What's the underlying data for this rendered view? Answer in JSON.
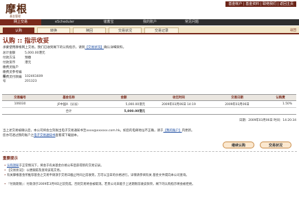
{
  "header": {
    "logo_text": "摩根",
    "logo_sub": "基金管理",
    "top_links": "基金帐户 | 基金资料 | 联络我们 | 返回主页"
  },
  "nav": {
    "items": [
      {
        "label": "网上交易"
      },
      {
        "label": "eScheduler"
      },
      {
        "label": "储蓄宝"
      },
      {
        "label": "我的账户"
      },
      {
        "label": "常见问题"
      }
    ]
  },
  "subtabs": {
    "items": [
      {
        "label": "认购"
      },
      {
        "label": "转换"
      },
      {
        "label": "赎回"
      },
      {
        "label": "交易状况"
      },
      {
        "label": "交易记录"
      }
    ],
    "back_label": "返回"
  },
  "page": {
    "title": "认购 :: 指示收妥",
    "instruction_pre": "承蒙使用摩根网上交易。我们已收到阁下的认购指示，请到",
    "instruction_link": "【交易状况】",
    "instruction_post": "确认详细资料。"
  },
  "summary": [
    {
      "label": "总计金额",
      "value": "5,000.00港元"
    },
    {
      "label": "付款方法",
      "value": "预缴"
    },
    {
      "label": "付款货币",
      "value": "港元"
    },
    {
      "label": "缴费灵账户",
      "value": ""
    },
    {
      "label": "缴费灵参考编号",
      "value": "102461609"
    },
    {
      "label": "缴费灵付款编号",
      "value": "201323"
    }
  ],
  "table": {
    "headers": [
      "交易编号",
      "基金名称",
      "金额",
      "收讫时间",
      "交易日期",
      "认购费"
    ],
    "rows": [
      {
        "id": "106030",
        "fund": "JF中国A（分派）",
        "amount": "5,000.00港元",
        "received": "2009年03月06日 14:19",
        "trade_date": "2009年03月06日",
        "fee": "1.50%"
      }
    ],
    "total_label": "合计",
    "total_amount": "5,000.00港元"
  },
  "datetime": "日期：2009年03月06日 时间：14:20:34",
  "note": {
    "line1_pre": "当上述交易被确认后，本公司将会立刻发出电子交易通知书至xxxx@xxxxxx.com.hk。如您的电邮地址不正确，请于",
    "line1_link": "【我的账户】",
    "line1_post": "内更新。",
    "line2_pre": "您亦可透过我的账户之",
    "line2_link": "电子交易通知书",
    "line2_post": "查看或下载副本。"
  },
  "buttons": {
    "continue_label": "继续认购",
    "status_label": "交易状况"
  },
  "tips": {
    "title": "重要提示",
    "items": [
      {
        "link": "认购须知",
        "text": "于正常情况下，将会于有关基金价格公布后获得新的交易记录。"
      },
      {
        "link": "",
        "text": "【交易状况】：以便跟踪及查询该笔交易。"
      },
      {
        "link": "",
        "text": "有关摩根基金所推荐基金之交易申请须于交易日截止时间之前收到，方可以当日的价格进行。详情请参阅有关 基金文件或向本公司查询。"
      },
      {
        "link": "",
        "text": "『付款期限』：付款须于2009年3月9日之前完成，否则交易将会被取消。若贵公司未能于上述期限前收妥款项，阁下的认购指示将会被拒绝。"
      }
    ]
  },
  "colors": {
    "brand": "#7a2a1c",
    "nav_bg": "#2e2e2e",
    "link": "#1a4aa0"
  }
}
